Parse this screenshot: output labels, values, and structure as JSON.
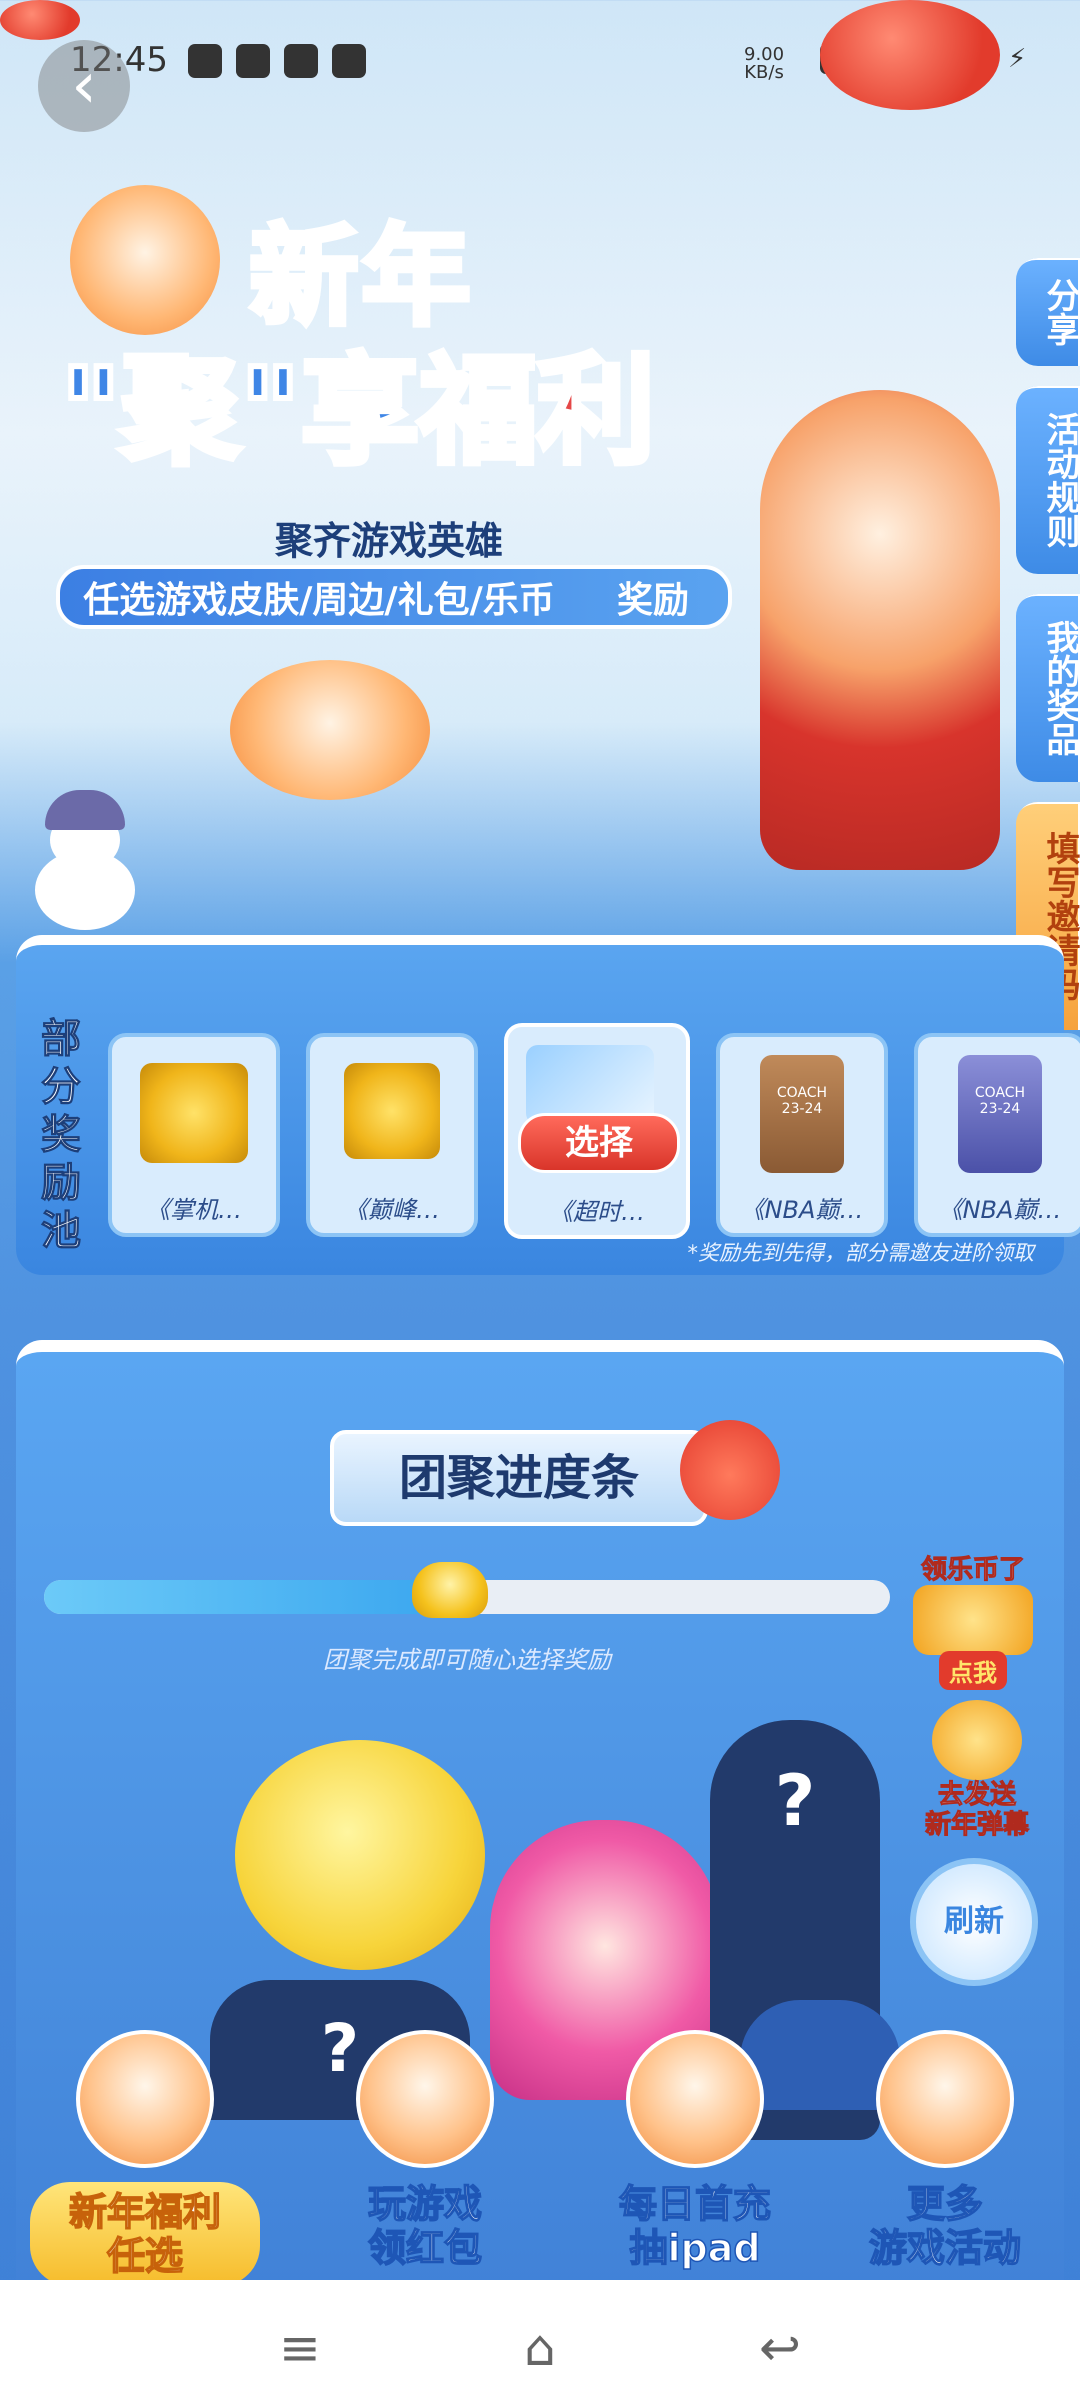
{
  "status_bar": {
    "time": "12:45",
    "net_speed_value": "9.00",
    "net_speed_unit": "KB/s",
    "battery_color": "#555555"
  },
  "header": {
    "back_icon": "chevron-left-icon",
    "title_line1": "新年",
    "title_line2_part1": "\"聚\"",
    "title_line2_part2": "享",
    "title_line2_part3": "福利",
    "subtitle": "聚齐游戏英雄",
    "pill_text": "任选游戏皮肤/周边/礼包/乐币",
    "pill_tag": "奖励"
  },
  "side_tabs": [
    {
      "label": "分享"
    },
    {
      "label": "活动规则"
    },
    {
      "label": "我的奖品"
    },
    {
      "label": "填写邀请码"
    }
  ],
  "reward_pool": {
    "title": "部分奖励池",
    "cards": [
      {
        "label": "《掌机…"
      },
      {
        "label": "《巅峰…"
      },
      {
        "label": "《超时…",
        "button": "选择"
      },
      {
        "label": "《NBA巅…"
      },
      {
        "label": "《NBA巅…"
      }
    ],
    "bag_caption": "COACH",
    "bag_season": "23-24",
    "note": "*奖励先到先得，部分需邀友进阶领取"
  },
  "progress": {
    "title": "团聚进度条",
    "hint": "团聚完成即可随心选择奖励",
    "fraction": 0.48
  },
  "float_buttons": {
    "collect_coin_top": "领乐币了",
    "collect_coin_tag": "点我",
    "danmaku_line1": "去发送",
    "danmaku_line2": "新年弹幕",
    "refresh": "刷新"
  },
  "stage": {
    "mystery_mark": "?"
  },
  "bottom_nav": [
    {
      "line1": "新年福利",
      "line2": "任选",
      "active": true
    },
    {
      "line1": "玩游戏",
      "line2": "领红包",
      "active": false
    },
    {
      "line1": "每日首充",
      "line2": "抽ipad",
      "active": false
    },
    {
      "line1": "更多",
      "line2": "游戏活动",
      "active": false
    }
  ],
  "system_nav": {
    "menu_icon": "≡",
    "home_icon": "⌂",
    "back_icon": "↩"
  }
}
